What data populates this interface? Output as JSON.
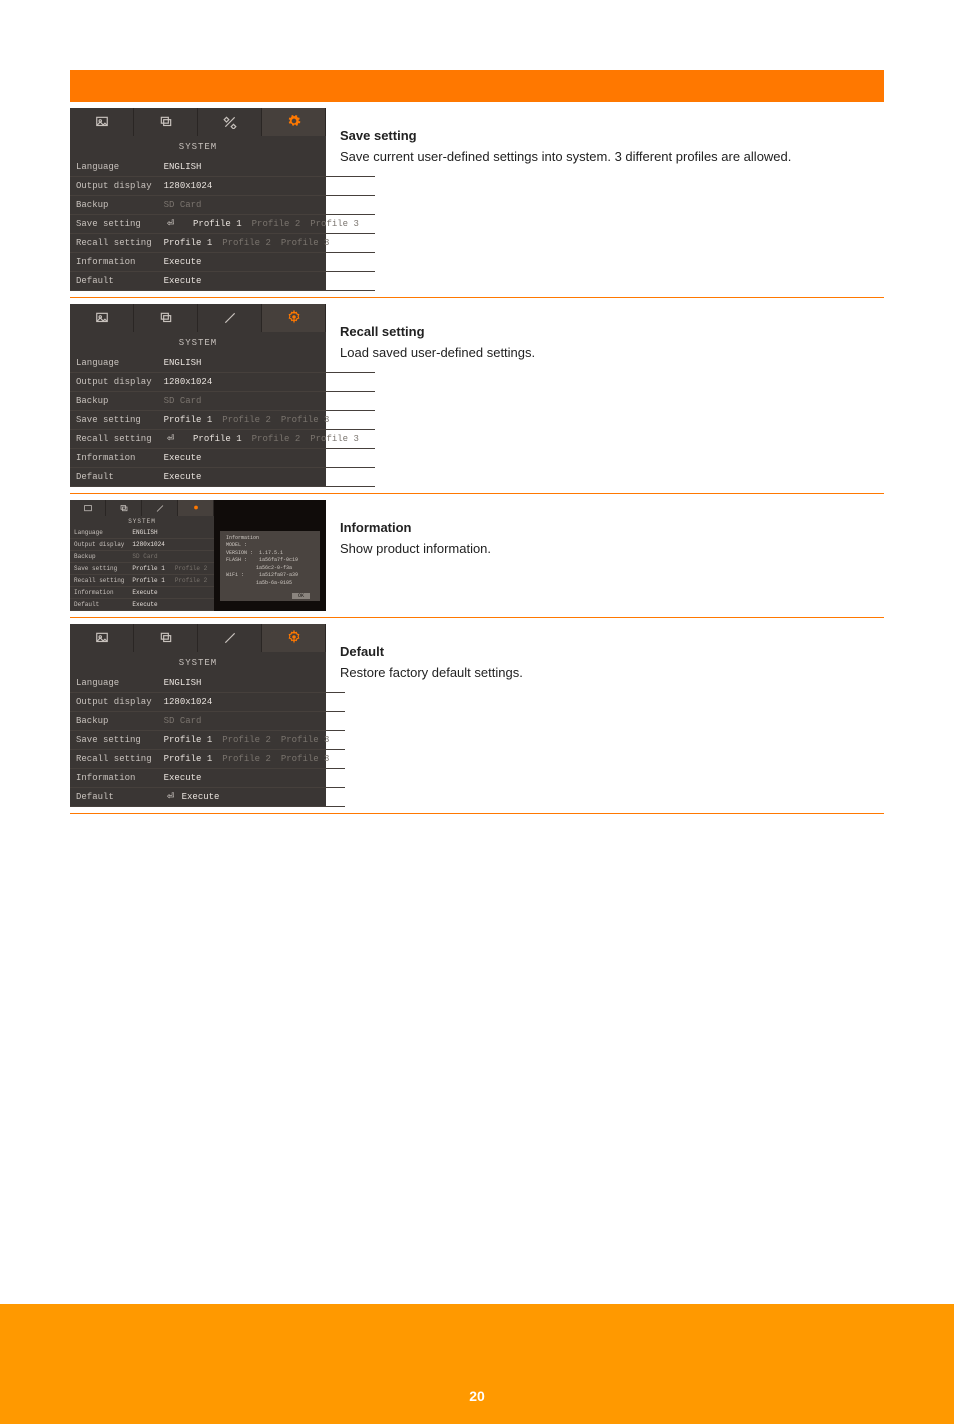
{
  "page_number": "20",
  "tabs_title": "SYSTEM",
  "menu": {
    "language": {
      "label": "Language",
      "value": "ENGLISH"
    },
    "output": {
      "label": "Output display",
      "value": "1280x1024"
    },
    "backup": {
      "label": "Backup",
      "value": "SD Card"
    },
    "save": {
      "label": "Save setting",
      "p1": "Profile 1",
      "p2": "Profile 2",
      "p3": "Profile 3"
    },
    "recall": {
      "label": "Recall setting",
      "p1": "Profile 1",
      "p2": "Profile 2",
      "p3": "Profile 3"
    },
    "info": {
      "label": "Information",
      "value": "Execute"
    },
    "default": {
      "label": "Default",
      "value": "Execute"
    }
  },
  "info_popup": {
    "title": "Information",
    "model_label": "MODEL :",
    "version_label": "VERSION :",
    "version_value": "1.17.5.1",
    "flash_label": "FLASH :",
    "flash_value1": "1a56fa7f-0c19",
    "flash_value2": "1a56c2-0-f3a",
    "wifi_label": "WiFi :",
    "wifi_value1": "1a512fa87-a39",
    "wifi_value2": "1a5b-6a-0105",
    "ok": "OK"
  },
  "rows": {
    "save": {
      "title": "Save setting",
      "body": "Save current user-defined settings into system. 3 different profiles are allowed."
    },
    "recall": {
      "title": "Recall setting",
      "body": "Load saved user-defined settings."
    },
    "info": {
      "title": "Information",
      "body": "Show product information."
    },
    "default": {
      "title": "Default",
      "body": "Restore factory default settings."
    }
  },
  "icons": {
    "picture": "picture-icon",
    "layers": "layers-icon",
    "tools": "tools-icon",
    "gear": "gear-icon",
    "enter": "enter-arrow-icon"
  }
}
